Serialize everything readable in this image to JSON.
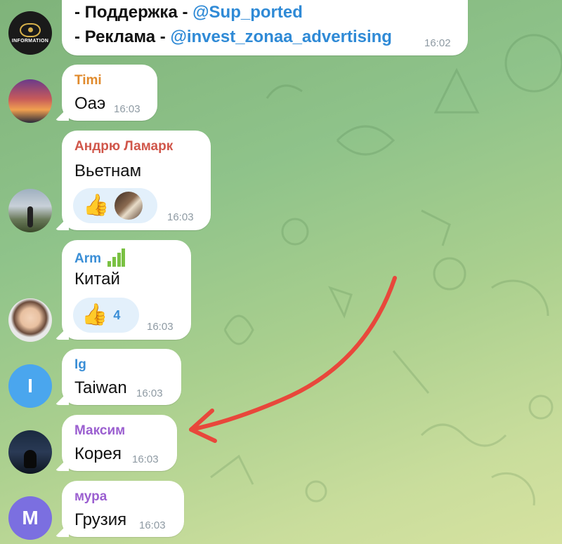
{
  "messages": {
    "channel": {
      "avatar_text": "INFORMATION",
      "line1_prefix": "- Поддержка - ",
      "line1_link": "@Sup_ported",
      "line2_prefix": "- Реклама - ",
      "line2_link": "@invest_zonaa_advertising",
      "time": "16:02"
    },
    "timi": {
      "name": "Timi",
      "name_color": "#e08a2c",
      "text": "Оаэ",
      "time": "16:03"
    },
    "andryu": {
      "name": "Андрю Ламарк",
      "name_color": "#d0564a",
      "text": "Вьетнам",
      "time": "16:03",
      "reaction_emoji": "👍"
    },
    "arm": {
      "name": "Arm",
      "name_color": "#3a8ed6",
      "status_icon": "signal-bars-icon",
      "text": "Китай",
      "time": "16:03",
      "reaction_emoji": "👍",
      "reaction_count": "4"
    },
    "ig": {
      "name": "Ig",
      "name_color": "#3a8ed6",
      "avatar_letter": "I",
      "text": "Taiwan",
      "time": "16:03"
    },
    "maksim": {
      "name": "Максим",
      "name_color": "#9b5fd0",
      "text": "Корея",
      "time": "16:03"
    },
    "mura": {
      "name": "мура",
      "name_color": "#9b5fd0",
      "avatar_letter": "M",
      "text": "Грузия",
      "time": "16:03"
    }
  },
  "colors": {
    "arrow": "#e8473b",
    "ig_avatar": "#4aa6ee",
    "mura_avatar": "#7b6fe0"
  }
}
